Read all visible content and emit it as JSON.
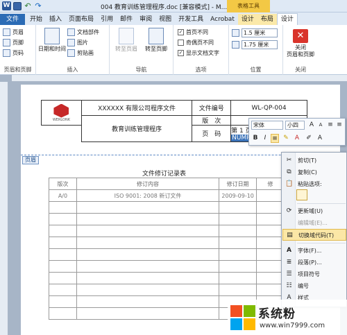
{
  "window": {
    "title": "004 教育训练管理程序.doc [兼容模式] - M...",
    "contextual_tab_title": "表格工具"
  },
  "tabs": [
    "文件",
    "开始",
    "插入",
    "页面布局",
    "引用",
    "邮件",
    "审阅",
    "视图",
    "开发工具",
    "Acrobat",
    "设计",
    "布局",
    "设计"
  ],
  "ribbon": {
    "hf_group": {
      "items": [
        "页眉",
        "页脚",
        "页码"
      ],
      "label": "页眉和页脚"
    },
    "insert_group": {
      "big": "日期和时间",
      "items": [
        "文档部件",
        "图片",
        "剪贴画"
      ],
      "label": "插入"
    },
    "nav_group": {
      "items": [
        "转至页眉",
        "转至页脚"
      ],
      "label": "导航"
    },
    "options_group": {
      "items": [
        {
          "label": "首页不同",
          "checked": true
        },
        {
          "label": "奇偶页不同",
          "checked": false
        },
        {
          "label": "显示文档文字",
          "checked": true
        }
      ],
      "label": "选项"
    },
    "position_group": {
      "values": [
        "1.5 厘米",
        "1.75 厘米"
      ],
      "label": "位置"
    },
    "close_group": {
      "button": "关闭\n页眉和页脚",
      "button_line1": "关闭",
      "button_line2": "页眉和页脚",
      "label": "关闭"
    }
  },
  "header_table": {
    "logo_text": "WERLONK",
    "company": "XXXXXX 有限公司程序文件",
    "doc_no_label": "文件编号",
    "doc_no_value": "WL-QP-004",
    "title": "教育训练管理程序",
    "version_label": "版　次",
    "page_label": "页　码",
    "page_value": "第 1 页",
    "field_code": "NUMPAGES}-1"
  },
  "header_tag": "页眉",
  "revision": {
    "title": "文件修订记录表",
    "columns": [
      "版次",
      "修订内容",
      "修订日期",
      "修"
    ],
    "rows": [
      [
        "A/0",
        "ISO 9001: 2008 新订文件",
        "2009-09-10",
        ""
      ]
    ],
    "empty_rows": 10
  },
  "mini_toolbar": {
    "font": "宋体",
    "size": "小四",
    "buttons": [
      "B",
      "I",
      "U"
    ]
  },
  "context_menu": {
    "items": [
      {
        "label": "剪切(T)",
        "icon": "scissors-icon",
        "disabled": false
      },
      {
        "label": "复制(C)",
        "icon": "copy-icon",
        "disabled": false
      },
      {
        "label": "粘贴选项:",
        "icon": "paste-icon",
        "disabled": false
      },
      {
        "label": "更新域(U)",
        "icon": "update-field-icon",
        "disabled": false
      },
      {
        "label": "编辑域(E)...",
        "icon": "",
        "disabled": true
      },
      {
        "label": "切换域代码(T)",
        "icon": "toggle-field-codes-icon",
        "disabled": false,
        "highlighted": true
      },
      {
        "label": "字体(F)...",
        "icon": "font-icon",
        "disabled": false
      },
      {
        "label": "段落(P)...",
        "icon": "paragraph-icon",
        "disabled": false
      },
      {
        "label": "项目符号",
        "icon": "bullets-icon",
        "disabled": false
      },
      {
        "label": "编号",
        "icon": "numbering-icon",
        "disabled": false
      },
      {
        "label": "样式",
        "icon": "styles-icon",
        "disabled": false
      }
    ]
  },
  "watermark": {
    "title": "系统粉",
    "url": "www.win7999.com"
  },
  "colors": {
    "accent": "#2b6bb5",
    "contextual": "#f3c845",
    "highlight": "#fbe7a6"
  }
}
